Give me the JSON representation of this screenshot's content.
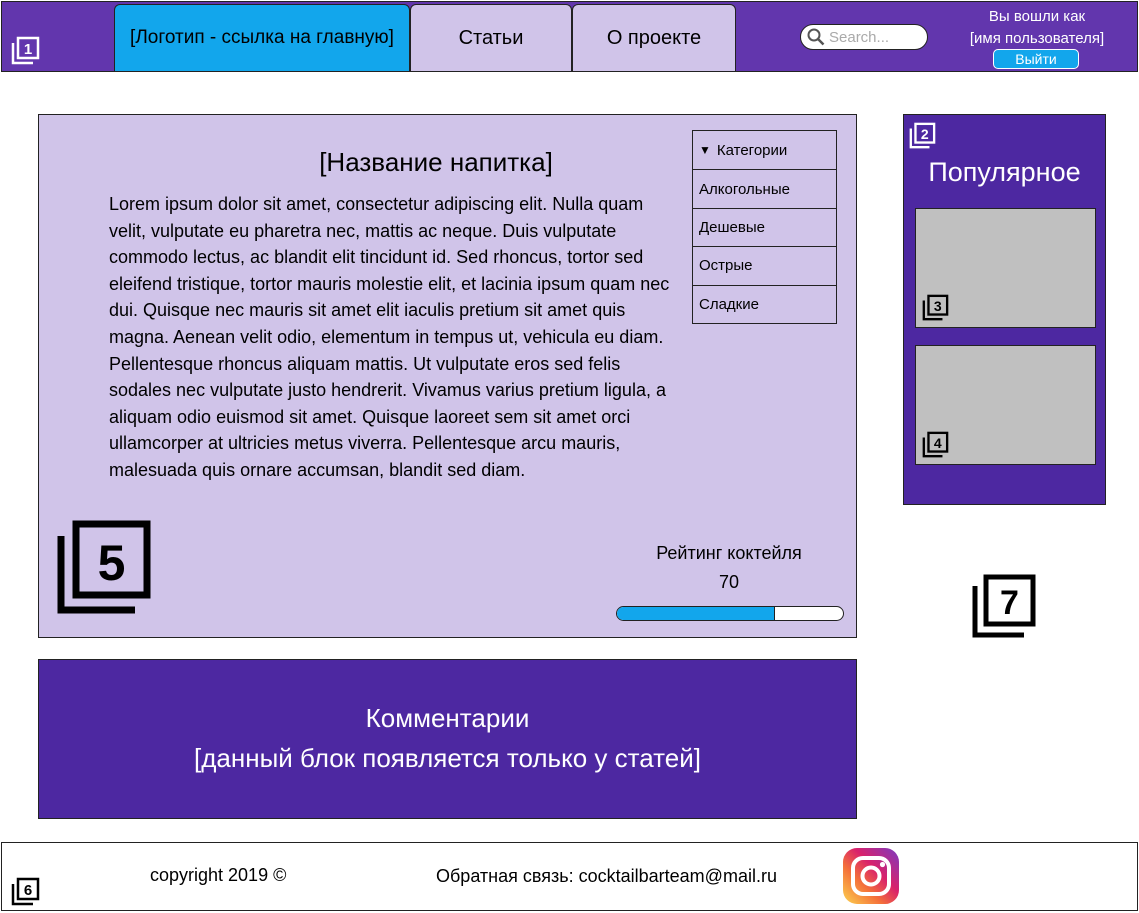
{
  "header": {
    "logo_tab": "[Логотип - ссылка на главную]",
    "articles_tab": "Статьи",
    "about_tab": "О проекте",
    "search_placeholder": "Search...",
    "logged_in_line1": "Вы вошли как",
    "logged_in_line2": "[имя пользователя]",
    "logout_label": "Выйти",
    "badge": "1"
  },
  "article": {
    "title": "[Название напитка]",
    "text": "Lorem ipsum dolor sit amet, consectetur adipiscing elit. Nulla quam velit, vulputate eu pharetra nec, mattis ac neque. Duis vulputate commodo lectus, ac blandit elit tincidunt id. Sed rhoncus, tortor sed eleifend tristique, tortor mauris molestie elit, et lacinia ipsum quam nec dui. Quisque nec mauris sit amet elit iaculis pretium sit amet quis magna. Aenean velit odio, elementum in tempus ut, vehicula eu diam. Pellentesque rhoncus aliquam mattis. Ut vulputate eros sed felis sodales nec vulputate justo hendrerit. Vivamus varius pretium ligula, a aliquam odio euismod sit amet. Quisque laoreet sem sit amet orci ullamcorper at ultricies metus viverra. Pellentesque arcu mauris, malesuada quis ornare accumsan, blandit sed diam.",
    "rating_label": "Рейтинг коктейля",
    "rating_value": "70",
    "rating_fraction": 0.7,
    "badge": "5"
  },
  "categories": {
    "header": "Категории",
    "items": [
      "Алкогольные",
      "Дешевые",
      "Острые",
      "Сладкие"
    ]
  },
  "popular": {
    "title": "Популярное",
    "badge": "2",
    "card_badges": [
      "3",
      "4"
    ]
  },
  "side_badge": "7",
  "comments": {
    "line1": "Комментарии",
    "line2": "[данный блок появляется только у статей]"
  },
  "footer": {
    "copyright": "copyright 2019 ©",
    "feedback": "Обратная связь: cocktailbarteam@mail.ru",
    "badge": "6"
  },
  "colors": {
    "header_bg": "#6236ad",
    "accent_blue": "#12a6ec",
    "card_lavender": "#d0c4e9",
    "dark_purple": "#4d28a1",
    "placeholder_gray": "#c0c0c0"
  }
}
